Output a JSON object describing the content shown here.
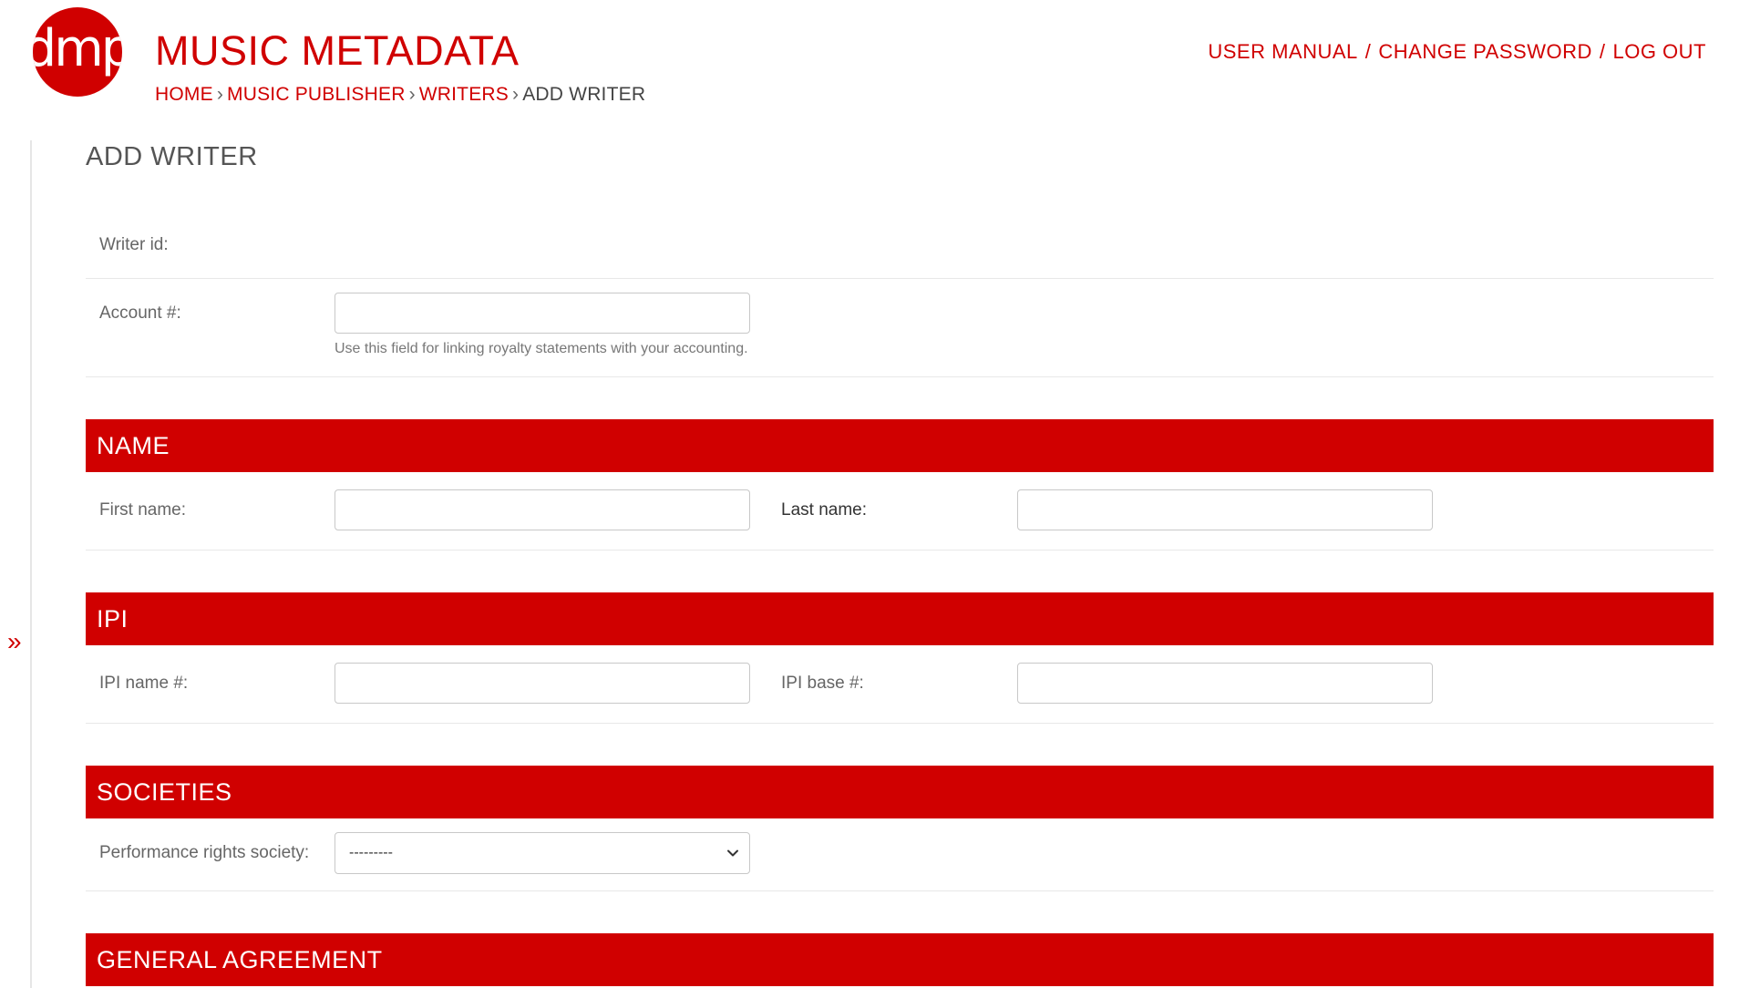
{
  "brand": {
    "logo_text": "dmp",
    "title": "MUSIC METADATA",
    "color": "#d00000"
  },
  "breadcrumbs": {
    "items": [
      "HOME",
      "MUSIC PUBLISHER",
      "WRITERS"
    ],
    "separator": "›",
    "current": "ADD WRITER"
  },
  "user_tools": {
    "manual": "USER MANUAL",
    "change_password": "CHANGE PASSWORD",
    "logout": "LOG OUT",
    "separator": "/"
  },
  "nav_toggle": "»",
  "page": {
    "title": "ADD WRITER"
  },
  "fields": {
    "writer_id_label": "Writer id:",
    "account_label": "Account #:",
    "account_help": "Use this field for linking royalty statements with your accounting.",
    "first_name_label": "First name:",
    "last_name_label": "Last name:",
    "ipi_name_label": "IPI name #:",
    "ipi_base_label": "IPI base #:",
    "pro_label": "Performance rights society:",
    "pro_selected": "---------"
  },
  "sections": {
    "name": "NAME",
    "ipi": "IPI",
    "societies": "SOCIETIES",
    "general_agreement": "GENERAL AGREEMENT"
  },
  "icons": {
    "select_arrow": "chevron-down-icon"
  }
}
